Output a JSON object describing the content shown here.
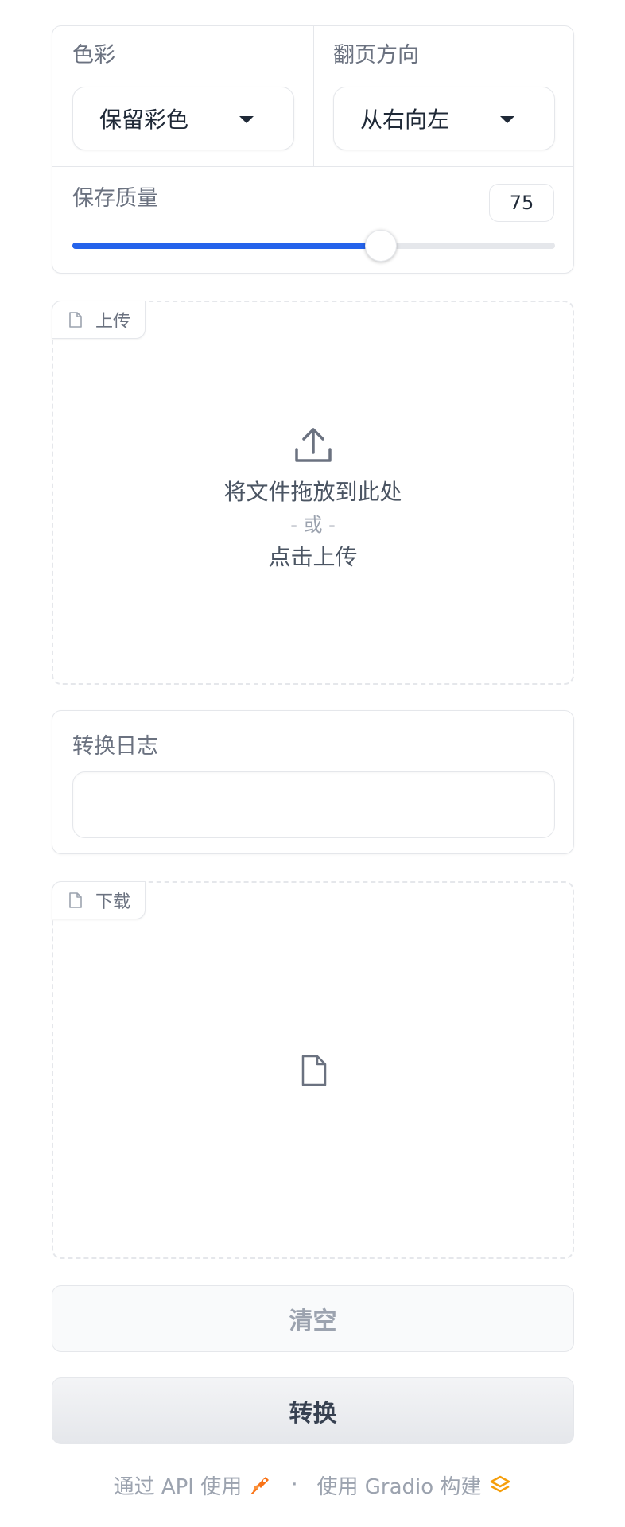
{
  "settings": {
    "color": {
      "label": "色彩",
      "value": "保留彩色"
    },
    "direction": {
      "label": "翻页方向",
      "value": "从右向左"
    },
    "quality": {
      "label": "保存质量",
      "value": "75",
      "fraction": 0.64
    }
  },
  "upload": {
    "tag": "上传",
    "drop_text": "将文件拖放到此处",
    "or_text": "- 或 -",
    "click_text": "点击上传"
  },
  "log": {
    "label": "转换日志",
    "value": ""
  },
  "download": {
    "tag": "下载"
  },
  "buttons": {
    "clear": "清空",
    "convert": "转换"
  },
  "footer": {
    "api_text": "通过 API 使用",
    "separator": "·",
    "built_text": "使用 Gradio 构建"
  },
  "colors": {
    "accent": "#2563eb",
    "api_icon": "#f97316",
    "gradio_icon": "#f59e0b"
  },
  "icons": [
    "file-icon",
    "upload-icon",
    "rocket-icon",
    "gradio-logo-icon",
    "caret-down-icon"
  ]
}
